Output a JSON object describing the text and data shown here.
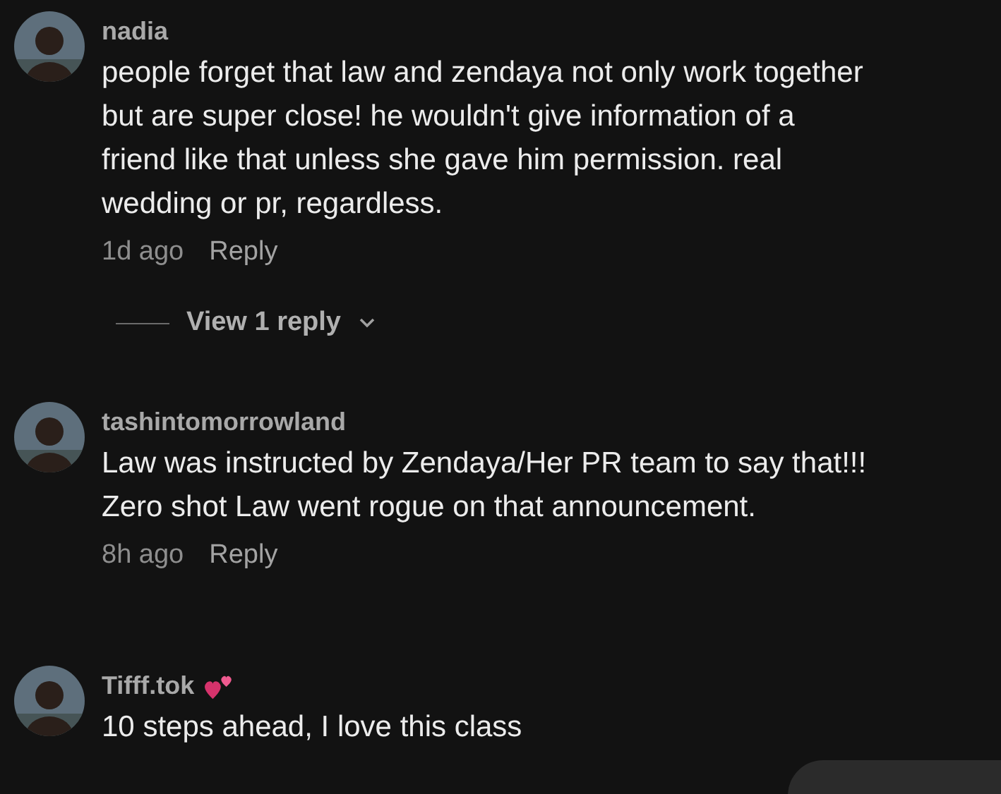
{
  "comments": [
    {
      "username": "nadia",
      "hearts": false,
      "lines": [
        "people forget that law and zendaya not only work together",
        "but are super close! he wouldn't give information of a",
        "friend like that unless she gave him permission. real",
        "wedding or pr, regardless."
      ],
      "time": "1d ago",
      "reply": "Reply",
      "view_replies": "View 1 reply"
    },
    {
      "username": "tashintomorrowland",
      "hearts": false,
      "lines": [
        "Law was instructed by Zendaya/Her PR team to say that!!!",
        "Zero shot Law went rogue on that announcement."
      ],
      "time": "8h ago",
      "reply": "Reply"
    },
    {
      "username": "Tifff.tok",
      "hearts": true,
      "lines": [
        "10 steps ahead, I love this class"
      ]
    }
  ],
  "floating_button": {
    "kind": "pill"
  }
}
